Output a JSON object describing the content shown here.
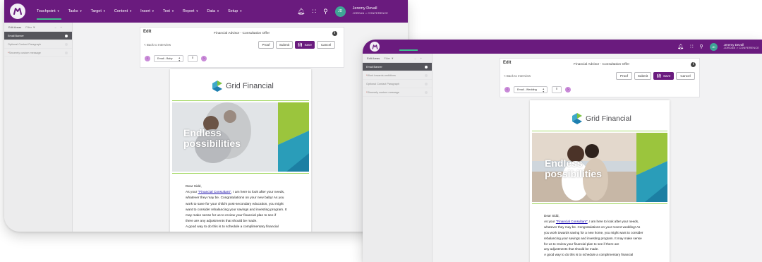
{
  "nav": {
    "items": [
      "Touchpoint",
      "Tasks",
      "Target",
      "Content",
      "Insert",
      "Text",
      "Report",
      "Data",
      "Setup"
    ],
    "user_name": "Jeremy Devall",
    "user_sub": "JORDAN > CONFERENCE",
    "user_initials": "JD"
  },
  "sidebar": {
    "header_label": "Edit Areas",
    "filter_label": "Filter",
    "window1_items": [
      {
        "label": "Email Banner",
        "required": false,
        "selected": true
      },
      {
        "label": "Optional Contact Paragraph",
        "required": false,
        "selected": false
      },
      {
        "label": "Sincerely custom message",
        "required": true,
        "selected": false
      }
    ],
    "window2_items": [
      {
        "label": "Email Banner",
        "required": false,
        "selected": true
      },
      {
        "label": "Work towards ambitions",
        "required": true,
        "selected": false
      },
      {
        "label": "Optional Contact Paragraph",
        "required": false,
        "selected": false
      },
      {
        "label": "Sincerely custom message",
        "required": true,
        "selected": false
      }
    ]
  },
  "editor": {
    "edit_title": "Edit",
    "center_title": "Financial Advisor - Consultation Offer",
    "back_link": "< Back to Interview",
    "proof_label": "Proof",
    "submit_label": "Submit",
    "save_label": "Save",
    "cancel_label": "Cancel",
    "w1_variant": "Email - Baby",
    "w2_variant": "Email - Wedding"
  },
  "email": {
    "brand_name": "Grid Financial",
    "hero_line1": "Endless",
    "hero_line2": "possibilities",
    "greeting": "Dear Sidd,",
    "merge_field": "\"Financial Consultant\"",
    "w1_lines": [
      "whatever they may be. Congratulations on your new baby! As you",
      "work to save for your child's post-secondary education, you might",
      "want to consider rebalancing your savings and investing program. It",
      "may make sense for us to review your financial plan to see if",
      "there are any adjustments that should be made.",
      "A good way to do this is to schedule a complimentary financial"
    ],
    "w2_lines": [
      "whatever they may be. Congratulations on your recent wedding! As",
      "you work towards saving for a new home, you might want to consider",
      "rebalancing your savings and investing program. It may make sense",
      "for us to review your financial plan to see if there are",
      "any adjustments that should be made.",
      "A good way to do this is to schedule a complimentary financial"
    ],
    "line1_prefix": "As your ",
    "line1_suffix": ", I am here to look after your needs,"
  },
  "colors": {
    "brand_purple": "#6a1b7e",
    "accent_green": "#3fc08e",
    "logo_green": "#7cc242",
    "logo_teal": "#1d9bb8"
  },
  "icons": [
    "bell-icon",
    "grid-icon",
    "search-icon",
    "info-icon",
    "save-icon",
    "upload-icon",
    "chevron-left-icon",
    "chevron-right-icon"
  ]
}
